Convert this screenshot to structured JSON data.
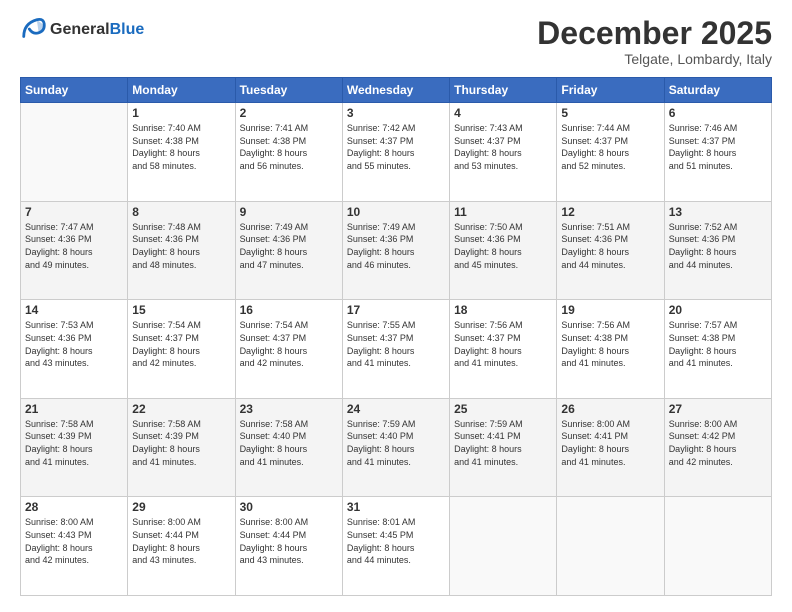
{
  "header": {
    "logo_line1": "General",
    "logo_line2": "Blue",
    "month_title": "December 2025",
    "location": "Telgate, Lombardy, Italy"
  },
  "days_of_week": [
    "Sunday",
    "Monday",
    "Tuesday",
    "Wednesday",
    "Thursday",
    "Friday",
    "Saturday"
  ],
  "weeks": [
    [
      {
        "day": "",
        "sunrise": "",
        "sunset": "",
        "daylight": ""
      },
      {
        "day": "1",
        "sunrise": "Sunrise: 7:40 AM",
        "sunset": "Sunset: 4:38 PM",
        "daylight": "Daylight: 8 hours and 58 minutes."
      },
      {
        "day": "2",
        "sunrise": "Sunrise: 7:41 AM",
        "sunset": "Sunset: 4:38 PM",
        "daylight": "Daylight: 8 hours and 56 minutes."
      },
      {
        "day": "3",
        "sunrise": "Sunrise: 7:42 AM",
        "sunset": "Sunset: 4:37 PM",
        "daylight": "Daylight: 8 hours and 55 minutes."
      },
      {
        "day": "4",
        "sunrise": "Sunrise: 7:43 AM",
        "sunset": "Sunset: 4:37 PM",
        "daylight": "Daylight: 8 hours and 53 minutes."
      },
      {
        "day": "5",
        "sunrise": "Sunrise: 7:44 AM",
        "sunset": "Sunset: 4:37 PM",
        "daylight": "Daylight: 8 hours and 52 minutes."
      },
      {
        "day": "6",
        "sunrise": "Sunrise: 7:46 AM",
        "sunset": "Sunset: 4:37 PM",
        "daylight": "Daylight: 8 hours and 51 minutes."
      }
    ],
    [
      {
        "day": "7",
        "sunrise": "Sunrise: 7:47 AM",
        "sunset": "Sunset: 4:36 PM",
        "daylight": "Daylight: 8 hours and 49 minutes."
      },
      {
        "day": "8",
        "sunrise": "Sunrise: 7:48 AM",
        "sunset": "Sunset: 4:36 PM",
        "daylight": "Daylight: 8 hours and 48 minutes."
      },
      {
        "day": "9",
        "sunrise": "Sunrise: 7:49 AM",
        "sunset": "Sunset: 4:36 PM",
        "daylight": "Daylight: 8 hours and 47 minutes."
      },
      {
        "day": "10",
        "sunrise": "Sunrise: 7:49 AM",
        "sunset": "Sunset: 4:36 PM",
        "daylight": "Daylight: 8 hours and 46 minutes."
      },
      {
        "day": "11",
        "sunrise": "Sunrise: 7:50 AM",
        "sunset": "Sunset: 4:36 PM",
        "daylight": "Daylight: 8 hours and 45 minutes."
      },
      {
        "day": "12",
        "sunrise": "Sunrise: 7:51 AM",
        "sunset": "Sunset: 4:36 PM",
        "daylight": "Daylight: 8 hours and 44 minutes."
      },
      {
        "day": "13",
        "sunrise": "Sunrise: 7:52 AM",
        "sunset": "Sunset: 4:36 PM",
        "daylight": "Daylight: 8 hours and 44 minutes."
      }
    ],
    [
      {
        "day": "14",
        "sunrise": "Sunrise: 7:53 AM",
        "sunset": "Sunset: 4:36 PM",
        "daylight": "Daylight: 8 hours and 43 minutes."
      },
      {
        "day": "15",
        "sunrise": "Sunrise: 7:54 AM",
        "sunset": "Sunset: 4:37 PM",
        "daylight": "Daylight: 8 hours and 42 minutes."
      },
      {
        "day": "16",
        "sunrise": "Sunrise: 7:54 AM",
        "sunset": "Sunset: 4:37 PM",
        "daylight": "Daylight: 8 hours and 42 minutes."
      },
      {
        "day": "17",
        "sunrise": "Sunrise: 7:55 AM",
        "sunset": "Sunset: 4:37 PM",
        "daylight": "Daylight: 8 hours and 41 minutes."
      },
      {
        "day": "18",
        "sunrise": "Sunrise: 7:56 AM",
        "sunset": "Sunset: 4:37 PM",
        "daylight": "Daylight: 8 hours and 41 minutes."
      },
      {
        "day": "19",
        "sunrise": "Sunrise: 7:56 AM",
        "sunset": "Sunset: 4:38 PM",
        "daylight": "Daylight: 8 hours and 41 minutes."
      },
      {
        "day": "20",
        "sunrise": "Sunrise: 7:57 AM",
        "sunset": "Sunset: 4:38 PM",
        "daylight": "Daylight: 8 hours and 41 minutes."
      }
    ],
    [
      {
        "day": "21",
        "sunrise": "Sunrise: 7:58 AM",
        "sunset": "Sunset: 4:39 PM",
        "daylight": "Daylight: 8 hours and 41 minutes."
      },
      {
        "day": "22",
        "sunrise": "Sunrise: 7:58 AM",
        "sunset": "Sunset: 4:39 PM",
        "daylight": "Daylight: 8 hours and 41 minutes."
      },
      {
        "day": "23",
        "sunrise": "Sunrise: 7:58 AM",
        "sunset": "Sunset: 4:40 PM",
        "daylight": "Daylight: 8 hours and 41 minutes."
      },
      {
        "day": "24",
        "sunrise": "Sunrise: 7:59 AM",
        "sunset": "Sunset: 4:40 PM",
        "daylight": "Daylight: 8 hours and 41 minutes."
      },
      {
        "day": "25",
        "sunrise": "Sunrise: 7:59 AM",
        "sunset": "Sunset: 4:41 PM",
        "daylight": "Daylight: 8 hours and 41 minutes."
      },
      {
        "day": "26",
        "sunrise": "Sunrise: 8:00 AM",
        "sunset": "Sunset: 4:41 PM",
        "daylight": "Daylight: 8 hours and 41 minutes."
      },
      {
        "day": "27",
        "sunrise": "Sunrise: 8:00 AM",
        "sunset": "Sunset: 4:42 PM",
        "daylight": "Daylight: 8 hours and 42 minutes."
      }
    ],
    [
      {
        "day": "28",
        "sunrise": "Sunrise: 8:00 AM",
        "sunset": "Sunset: 4:43 PM",
        "daylight": "Daylight: 8 hours and 42 minutes."
      },
      {
        "day": "29",
        "sunrise": "Sunrise: 8:00 AM",
        "sunset": "Sunset: 4:44 PM",
        "daylight": "Daylight: 8 hours and 43 minutes."
      },
      {
        "day": "30",
        "sunrise": "Sunrise: 8:00 AM",
        "sunset": "Sunset: 4:44 PM",
        "daylight": "Daylight: 8 hours and 43 minutes."
      },
      {
        "day": "31",
        "sunrise": "Sunrise: 8:01 AM",
        "sunset": "Sunset: 4:45 PM",
        "daylight": "Daylight: 8 hours and 44 minutes."
      },
      {
        "day": "",
        "sunrise": "",
        "sunset": "",
        "daylight": ""
      },
      {
        "day": "",
        "sunrise": "",
        "sunset": "",
        "daylight": ""
      },
      {
        "day": "",
        "sunrise": "",
        "sunset": "",
        "daylight": ""
      }
    ]
  ]
}
